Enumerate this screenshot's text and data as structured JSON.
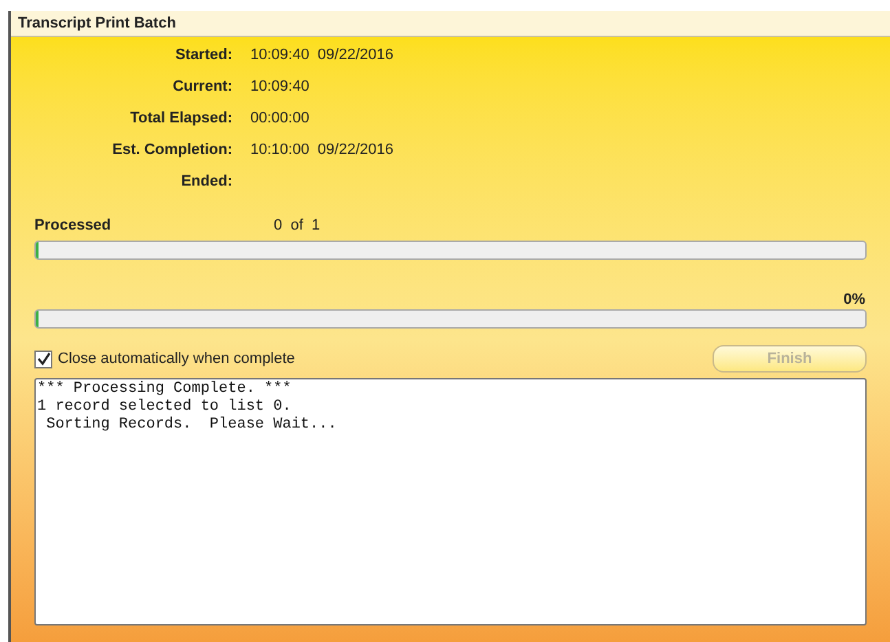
{
  "window": {
    "title": "Transcript Print Batch"
  },
  "fields": [
    {
      "label": "Started:",
      "value": "10:09:40  09/22/2016"
    },
    {
      "label": "Current:",
      "value": "10:09:40"
    },
    {
      "label": "Total Elapsed:",
      "value": "00:00:00"
    },
    {
      "label": "Est. Completion:",
      "value": "10:10:00  09/22/2016"
    },
    {
      "label": "Ended:"
    }
  ],
  "processed": {
    "label": "Processed",
    "count": "0  of  1",
    "level": 0
  },
  "progress": {
    "percent": "0%",
    "level": 0
  },
  "close_automatically": {
    "label": "Close automatically when complete",
    "checked": true
  },
  "finish_button": {
    "label": "Finish",
    "disabled": true
  },
  "log": [
    "*** Processing Complete. ***",
    "1 record selected to list 0.",
    " Sorting Records.  Please Wait..."
  ]
}
